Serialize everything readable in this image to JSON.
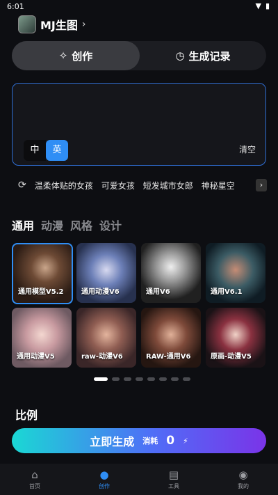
{
  "status": {
    "time": "6:01"
  },
  "header": {
    "title": "MJ生图",
    "chevron": "›"
  },
  "segments": {
    "create": "创作",
    "history": "生成记录"
  },
  "prompt": {
    "lang_zh": "中",
    "lang_en": "英",
    "clear": "清空"
  },
  "suggestions": [
    "温柔体贴的女孩",
    "可爱女孩",
    "短发城市女郎",
    "神秘星空"
  ],
  "categories": [
    {
      "label": "通用",
      "active": true
    },
    {
      "label": "动漫",
      "active": false
    },
    {
      "label": "风格",
      "active": false
    },
    {
      "label": "设计",
      "active": false
    }
  ],
  "models": [
    {
      "label": "通用模型V5.2",
      "selected": true
    },
    {
      "label": "通用动漫V6",
      "selected": false
    },
    {
      "label": "通用V6",
      "selected": false
    },
    {
      "label": "通用V6.1",
      "selected": false
    },
    {
      "label": "通用动漫V5",
      "selected": false
    },
    {
      "label": "raw-动漫V6",
      "selected": false
    },
    {
      "label": "RAW-通用V6",
      "selected": false
    },
    {
      "label": "原画-动漫V5",
      "selected": false
    }
  ],
  "pager": {
    "total": 8,
    "active": 0
  },
  "ratio": {
    "title": "比例"
  },
  "generate": {
    "label": "立即生成",
    "cost_label": "消耗",
    "cost_value": "0"
  },
  "tabs": [
    {
      "label": "首页",
      "icon": "home-icon",
      "active": false
    },
    {
      "label": "创作",
      "icon": "palette-icon",
      "active": true
    },
    {
      "label": "工具",
      "icon": "tools-icon",
      "active": false
    },
    {
      "label": "我的",
      "icon": "profile-icon",
      "active": false
    }
  ]
}
